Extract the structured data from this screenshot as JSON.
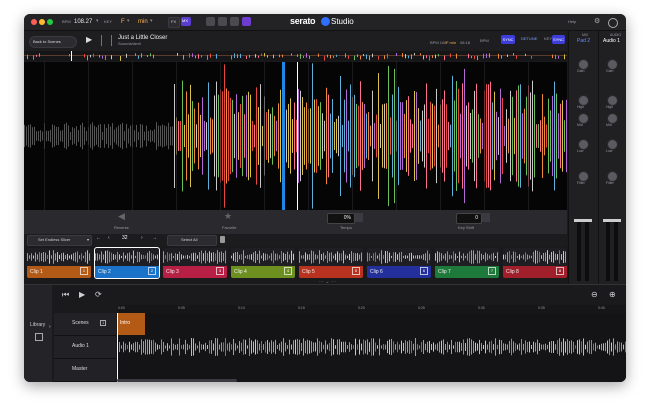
{
  "topbar": {
    "bpm_label": "BPM",
    "bpm_value": "108.27",
    "key_label": "KEY",
    "key_value": "F",
    "key_mode": "min",
    "fx_label": "FX",
    "mx_label": "MX",
    "help_label": "Help",
    "logo_text": "serato",
    "logo_studio": "Studio"
  },
  "deck": {
    "back_label": "Back to Scenes",
    "track_title": "Just a Little Closer",
    "track_artist": "Sounds/devil",
    "bpm_info": "BPM 108",
    "key_info": "F min",
    "time_info": "08:18",
    "bpm_tag": "BPM",
    "sync_label": "SYNC",
    "detune_label": "DETUNE",
    "key_tag": "KEY",
    "sync2_label": "SYNC"
  },
  "mixer": {
    "pad_title": "MIX",
    "pad_sub": "Pad 2",
    "audio_title": "AUDIO",
    "audio_sub": "Audio 1",
    "knobs": [
      "Gain",
      "High",
      "Mid",
      "Low",
      "Filter"
    ]
  },
  "controls": {
    "reverse": "Reverse",
    "favorite": "Favorite",
    "tempo_value": "0%",
    "tempo_label": "Tempo",
    "keyshift_value": "0",
    "keyshift_label": "Key Shift"
  },
  "cliptools": {
    "slicer_label": "Set Endless Slicer",
    "slice_count": "32",
    "select_all": "Select All"
  },
  "clips": [
    {
      "label": "Clip 1",
      "num": "1",
      "color": "#b35a16"
    },
    {
      "label": "Clip 2",
      "num": "2",
      "color": "#1a73c9"
    },
    {
      "label": "Clip 3",
      "num": "3",
      "color": "#b81f45"
    },
    {
      "label": "Clip 4",
      "num": "4",
      "color": "#6c8f1f"
    },
    {
      "label": "Clip 5",
      "num": "5",
      "color": "#b8321f"
    },
    {
      "label": "Clip 6",
      "num": "6",
      "color": "#23309b"
    },
    {
      "label": "Clip 7",
      "num": "7",
      "color": "#1d7a3a"
    },
    {
      "label": "Clip 8",
      "num": "8",
      "color": "#a01f2a"
    }
  ],
  "arranger": {
    "library_label": "Library",
    "ruler": [
      "0:00",
      "0:05",
      "0:10",
      "0:15",
      "0:20",
      "0:25",
      "0:30",
      "0:35",
      "0:40",
      "0:45"
    ],
    "tracks": [
      {
        "label": "Scenes",
        "num": "1"
      },
      {
        "label": "Audio 1",
        "num": ""
      },
      {
        "label": "Master",
        "num": ""
      }
    ],
    "scene_block": "Intro"
  }
}
